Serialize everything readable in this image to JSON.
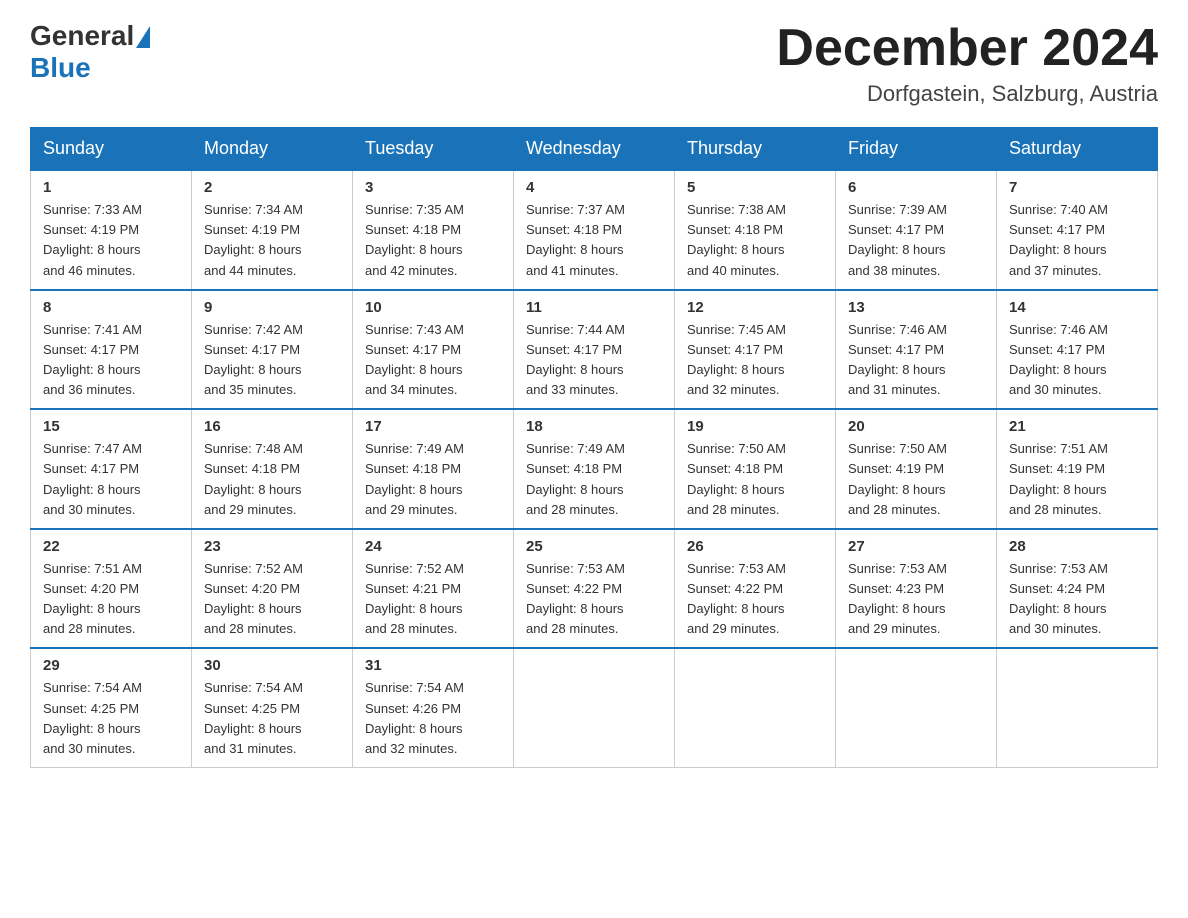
{
  "header": {
    "logo_general": "General",
    "logo_blue": "Blue",
    "month_title": "December 2024",
    "location": "Dorfgastein, Salzburg, Austria"
  },
  "weekdays": [
    "Sunday",
    "Monday",
    "Tuesday",
    "Wednesday",
    "Thursday",
    "Friday",
    "Saturday"
  ],
  "weeks": [
    [
      {
        "day": "1",
        "sunrise": "7:33 AM",
        "sunset": "4:19 PM",
        "daylight": "8 hours and 46 minutes."
      },
      {
        "day": "2",
        "sunrise": "7:34 AM",
        "sunset": "4:19 PM",
        "daylight": "8 hours and 44 minutes."
      },
      {
        "day": "3",
        "sunrise": "7:35 AM",
        "sunset": "4:18 PM",
        "daylight": "8 hours and 42 minutes."
      },
      {
        "day": "4",
        "sunrise": "7:37 AM",
        "sunset": "4:18 PM",
        "daylight": "8 hours and 41 minutes."
      },
      {
        "day": "5",
        "sunrise": "7:38 AM",
        "sunset": "4:18 PM",
        "daylight": "8 hours and 40 minutes."
      },
      {
        "day": "6",
        "sunrise": "7:39 AM",
        "sunset": "4:17 PM",
        "daylight": "8 hours and 38 minutes."
      },
      {
        "day": "7",
        "sunrise": "7:40 AM",
        "sunset": "4:17 PM",
        "daylight": "8 hours and 37 minutes."
      }
    ],
    [
      {
        "day": "8",
        "sunrise": "7:41 AM",
        "sunset": "4:17 PM",
        "daylight": "8 hours and 36 minutes."
      },
      {
        "day": "9",
        "sunrise": "7:42 AM",
        "sunset": "4:17 PM",
        "daylight": "8 hours and 35 minutes."
      },
      {
        "day": "10",
        "sunrise": "7:43 AM",
        "sunset": "4:17 PM",
        "daylight": "8 hours and 34 minutes."
      },
      {
        "day": "11",
        "sunrise": "7:44 AM",
        "sunset": "4:17 PM",
        "daylight": "8 hours and 33 minutes."
      },
      {
        "day": "12",
        "sunrise": "7:45 AM",
        "sunset": "4:17 PM",
        "daylight": "8 hours and 32 minutes."
      },
      {
        "day": "13",
        "sunrise": "7:46 AM",
        "sunset": "4:17 PM",
        "daylight": "8 hours and 31 minutes."
      },
      {
        "day": "14",
        "sunrise": "7:46 AM",
        "sunset": "4:17 PM",
        "daylight": "8 hours and 30 minutes."
      }
    ],
    [
      {
        "day": "15",
        "sunrise": "7:47 AM",
        "sunset": "4:17 PM",
        "daylight": "8 hours and 30 minutes."
      },
      {
        "day": "16",
        "sunrise": "7:48 AM",
        "sunset": "4:18 PM",
        "daylight": "8 hours and 29 minutes."
      },
      {
        "day": "17",
        "sunrise": "7:49 AM",
        "sunset": "4:18 PM",
        "daylight": "8 hours and 29 minutes."
      },
      {
        "day": "18",
        "sunrise": "7:49 AM",
        "sunset": "4:18 PM",
        "daylight": "8 hours and 28 minutes."
      },
      {
        "day": "19",
        "sunrise": "7:50 AM",
        "sunset": "4:18 PM",
        "daylight": "8 hours and 28 minutes."
      },
      {
        "day": "20",
        "sunrise": "7:50 AM",
        "sunset": "4:19 PM",
        "daylight": "8 hours and 28 minutes."
      },
      {
        "day": "21",
        "sunrise": "7:51 AM",
        "sunset": "4:19 PM",
        "daylight": "8 hours and 28 minutes."
      }
    ],
    [
      {
        "day": "22",
        "sunrise": "7:51 AM",
        "sunset": "4:20 PM",
        "daylight": "8 hours and 28 minutes."
      },
      {
        "day": "23",
        "sunrise": "7:52 AM",
        "sunset": "4:20 PM",
        "daylight": "8 hours and 28 minutes."
      },
      {
        "day": "24",
        "sunrise": "7:52 AM",
        "sunset": "4:21 PM",
        "daylight": "8 hours and 28 minutes."
      },
      {
        "day": "25",
        "sunrise": "7:53 AM",
        "sunset": "4:22 PM",
        "daylight": "8 hours and 28 minutes."
      },
      {
        "day": "26",
        "sunrise": "7:53 AM",
        "sunset": "4:22 PM",
        "daylight": "8 hours and 29 minutes."
      },
      {
        "day": "27",
        "sunrise": "7:53 AM",
        "sunset": "4:23 PM",
        "daylight": "8 hours and 29 minutes."
      },
      {
        "day": "28",
        "sunrise": "7:53 AM",
        "sunset": "4:24 PM",
        "daylight": "8 hours and 30 minutes."
      }
    ],
    [
      {
        "day": "29",
        "sunrise": "7:54 AM",
        "sunset": "4:25 PM",
        "daylight": "8 hours and 30 minutes."
      },
      {
        "day": "30",
        "sunrise": "7:54 AM",
        "sunset": "4:25 PM",
        "daylight": "8 hours and 31 minutes."
      },
      {
        "day": "31",
        "sunrise": "7:54 AM",
        "sunset": "4:26 PM",
        "daylight": "8 hours and 32 minutes."
      },
      null,
      null,
      null,
      null
    ]
  ],
  "labels": {
    "sunrise": "Sunrise:",
    "sunset": "Sunset:",
    "daylight": "Daylight:"
  }
}
